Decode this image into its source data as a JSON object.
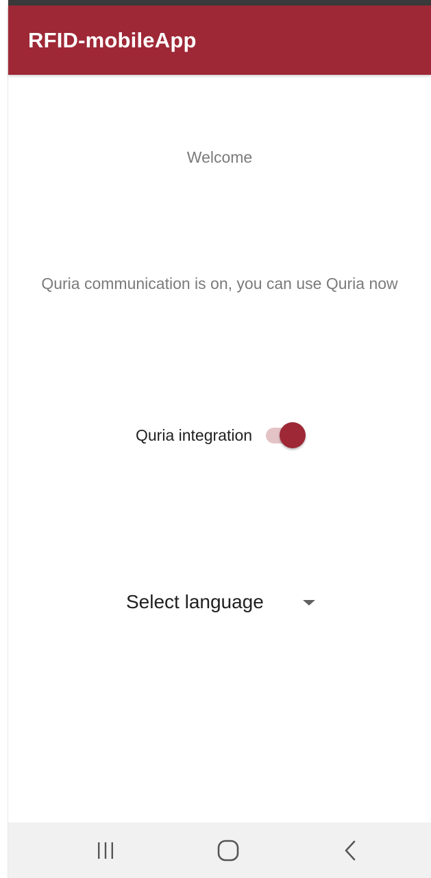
{
  "app_bar": {
    "title": "RFID-mobileApp",
    "color": "#9e2836"
  },
  "main": {
    "welcome_text": "Welcome",
    "status_text": "Quria communication is on, you can use Quria now",
    "integration": {
      "label": "Quria integration",
      "enabled": true,
      "accent_color": "#9e2836"
    },
    "language": {
      "label": "Select language",
      "icon": "dropdown-arrow-icon"
    }
  },
  "nav_bar": {
    "buttons": [
      {
        "name": "recents",
        "icon": "recents-icon"
      },
      {
        "name": "home",
        "icon": "home-icon"
      },
      {
        "name": "back",
        "icon": "back-icon"
      }
    ]
  }
}
